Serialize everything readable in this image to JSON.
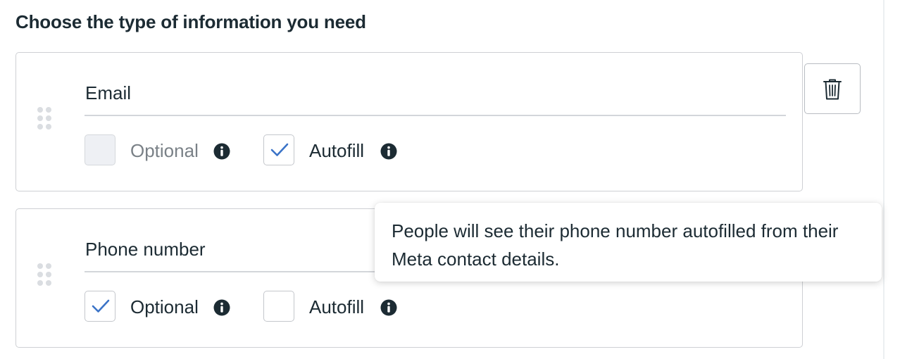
{
  "section": {
    "title": "Choose the type of information you need"
  },
  "fields": [
    {
      "label": "Email",
      "optional": {
        "label": "Optional",
        "checked": false,
        "disabled": true
      },
      "autofill": {
        "label": "Autofill",
        "checked": true,
        "disabled": false
      }
    },
    {
      "label": "Phone number",
      "optional": {
        "label": "Optional",
        "checked": true,
        "disabled": false
      },
      "autofill": {
        "label": "Autofill",
        "checked": false,
        "disabled": false
      }
    }
  ],
  "tooltip": {
    "text": "People will see their phone number autofilled from their Meta contact details."
  },
  "icons": {
    "info": "info-icon",
    "check": "checkmark-icon",
    "trash": "trash-icon",
    "drag": "drag-handle-icon"
  },
  "colors": {
    "check_accent": "#3b73c7",
    "text": "#1c2b33",
    "muted_text": "#7a8187",
    "border": "#ced0d4"
  }
}
